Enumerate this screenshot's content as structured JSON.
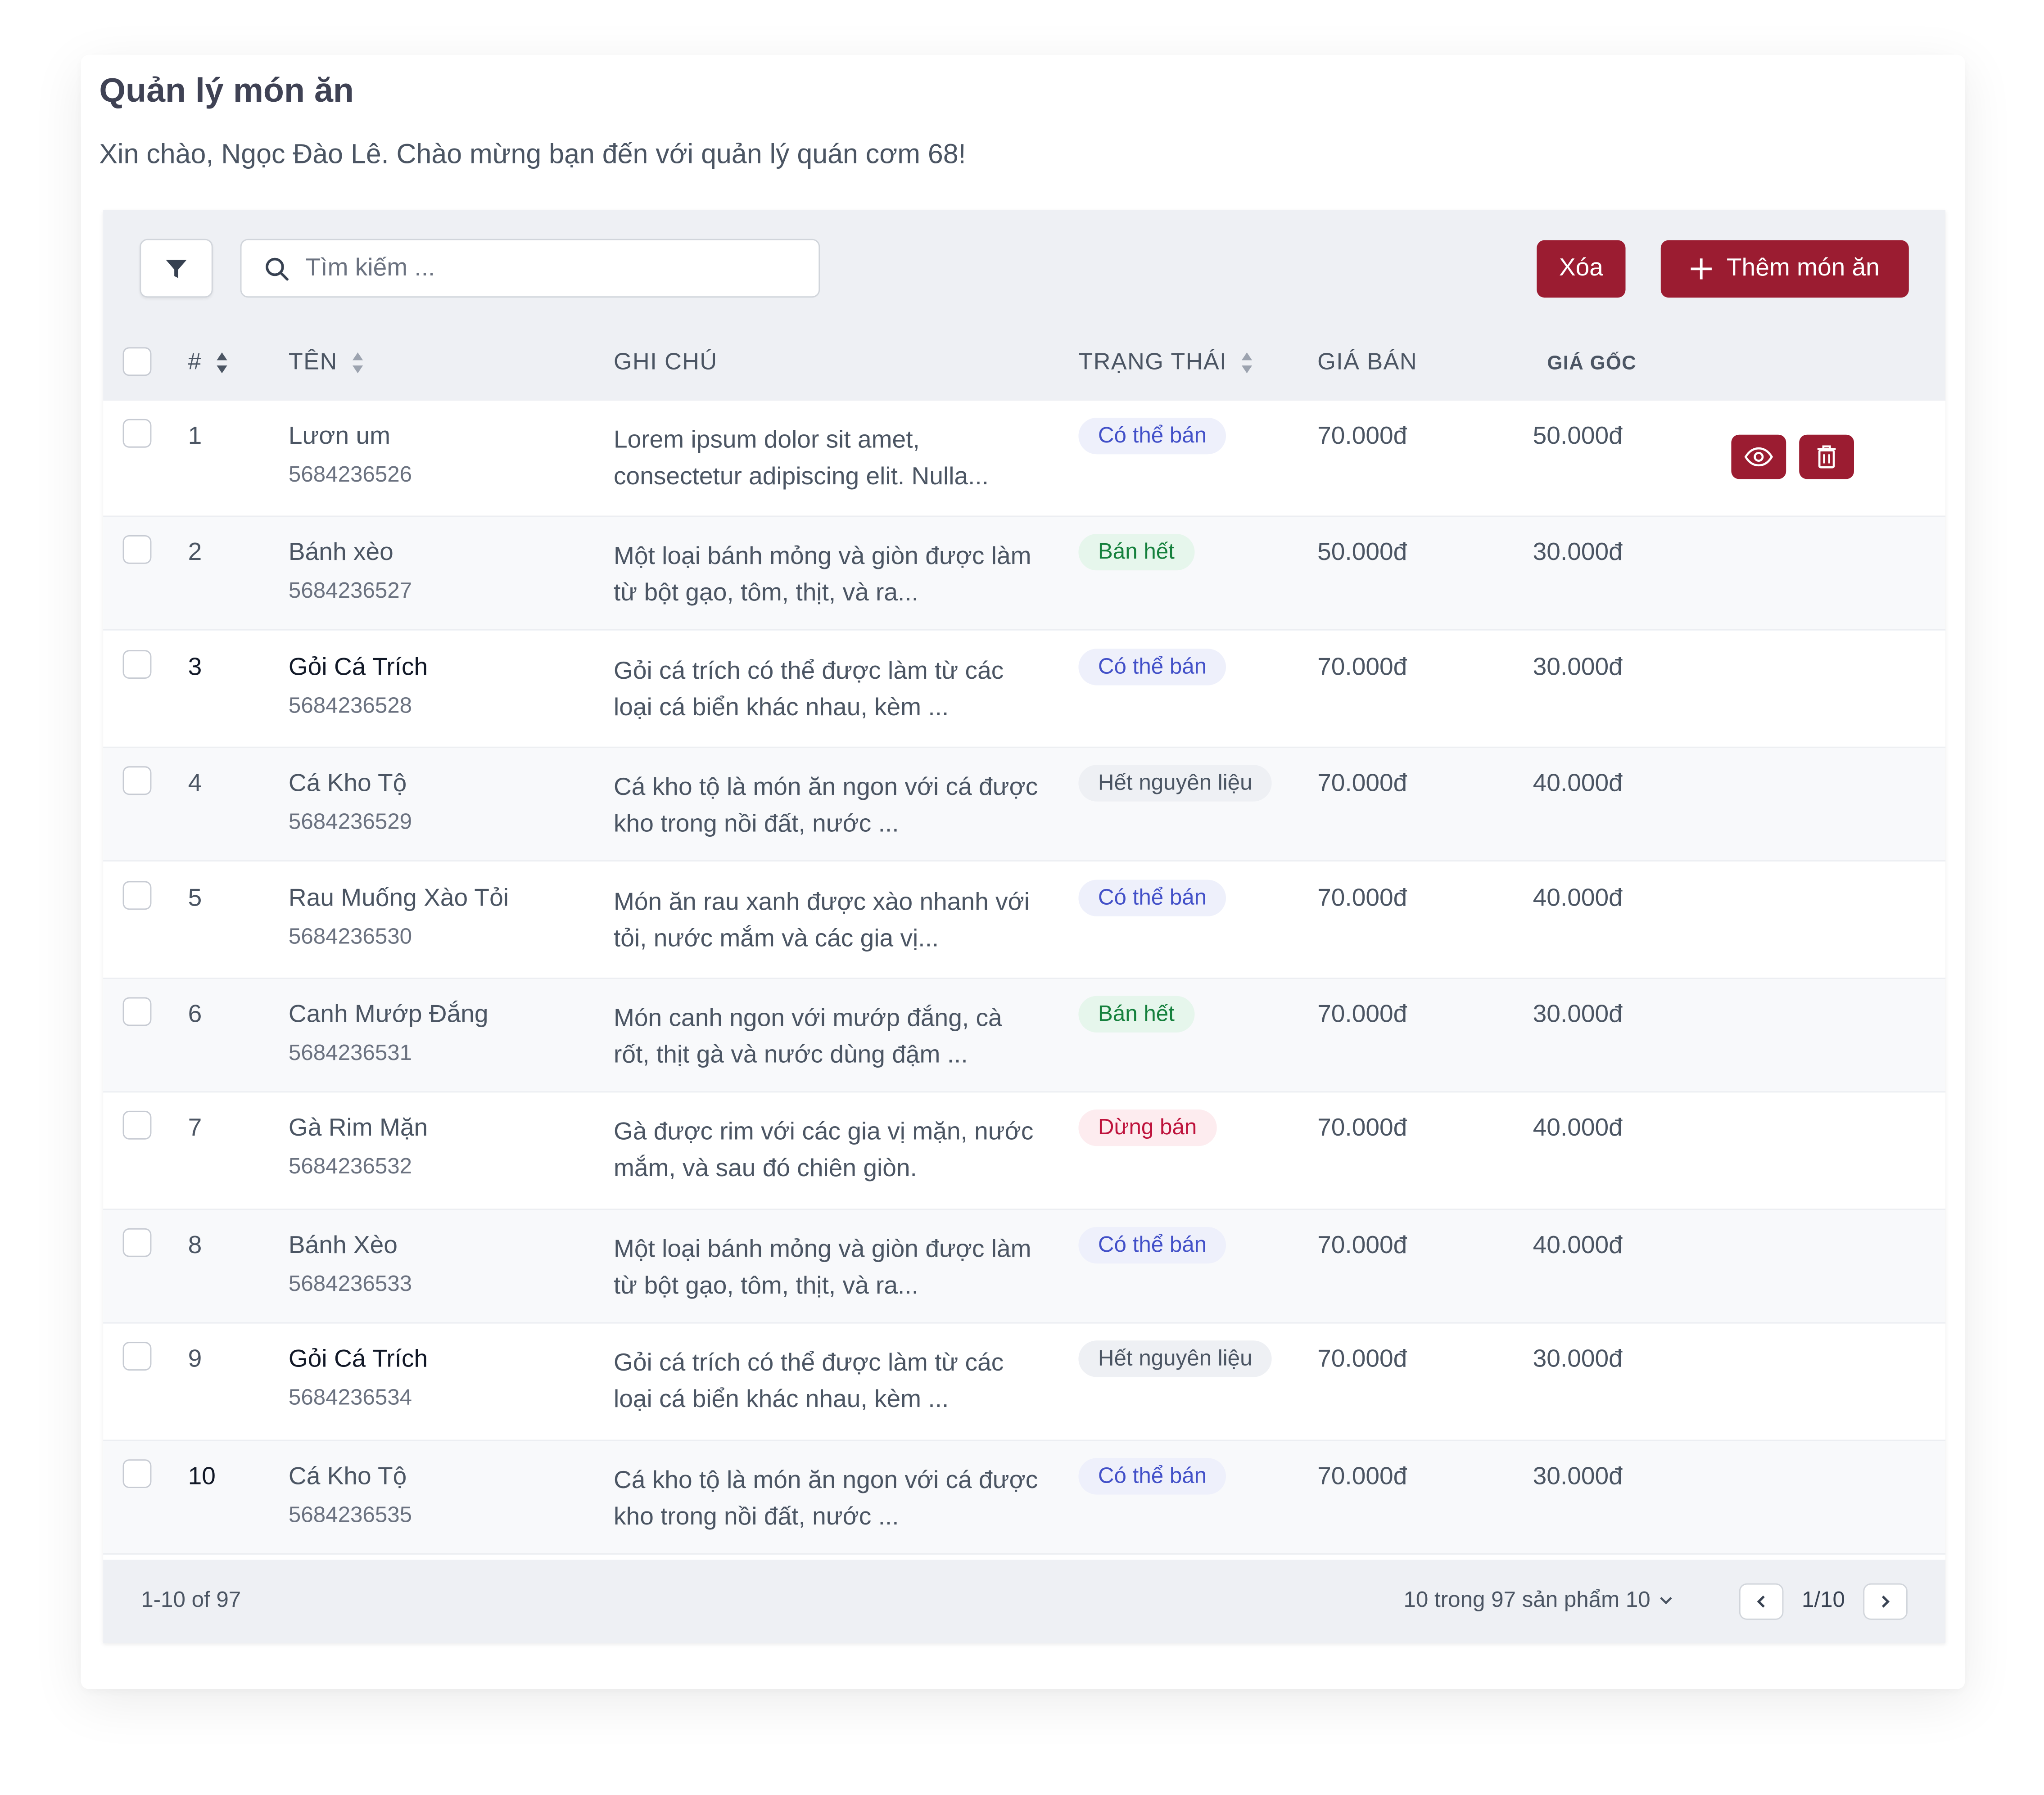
{
  "page": {
    "title": "Quản lý món ăn",
    "subtitle": "Xin chào, Ngọc Đào Lê. Chào mừng bạn đến với quản lý quán cơm 68!"
  },
  "toolbar": {
    "search_placeholder": "Tìm kiếm ...",
    "delete_label": "Xóa",
    "add_label": "Thêm món ăn"
  },
  "columns": {
    "index": "#",
    "name": "TÊN",
    "note": "GHI CHÚ",
    "status": "TRẠNG THÁI",
    "price": "GIÁ BÁN",
    "cost": "GIÁ GỐC"
  },
  "status_colors": {
    "Có thể bán": {
      "bg": "#eef0fb",
      "fg": "#4250c8"
    },
    "Bán hết": {
      "bg": "#e6f6ec",
      "fg": "#15803d"
    },
    "Hết nguyên liệu": {
      "bg": "#eef0f4",
      "fg": "#4b5563"
    },
    "Dừng bán": {
      "bg": "#fdecef",
      "fg": "#be123c"
    }
  },
  "rows": [
    {
      "index": "1",
      "name": "Lươn um",
      "code": "5684236526",
      "note": "Lorem ipsum dolor  sit amet, consectetur adipiscing elit. Nulla...",
      "status": "Có thể bán",
      "price": "70.000đ",
      "cost": "50.000đ",
      "bold": false
    },
    {
      "index": "2",
      "name": "Bánh xèo",
      "code": "5684236527",
      "note": "Một loại bánh mỏng và giòn được làm từ bột gạo, tôm, thịt, và ra...",
      "status": "Bán hết",
      "price": "50.000đ",
      "cost": "30.000đ",
      "bold": false
    },
    {
      "index": "3",
      "name": "Gỏi Cá Trích",
      "code": "5684236528",
      "note": "Gỏi cá trích có thể được làm từ các loại cá biển khác nhau, kèm ...",
      "status": "Có thể bán",
      "price": "70.000đ",
      "cost": "30.000đ",
      "bold": true
    },
    {
      "index": "4",
      "name": "Cá Kho Tộ",
      "code": "5684236529",
      "note": "Cá kho tộ là món ăn ngon với cá được kho trong nồi đất, nước ...",
      "status": "Hết nguyên liệu",
      "price": "70.000đ",
      "cost": "40.000đ",
      "bold": false
    },
    {
      "index": "5",
      "name": "Rau Muống Xào Tỏi",
      "code": "5684236530",
      "note": "Món ăn rau xanh được xào nhanh với tỏi, nước mắm và các gia vị...",
      "status": "Có thể bán",
      "price": "70.000đ",
      "cost": "40.000đ",
      "bold": false
    },
    {
      "index": "6",
      "name": "Canh Mướp Đắng",
      "code": "5684236531",
      "note": "Món canh ngon với mướp đắng, cà rốt, thịt gà và nước dùng đậm ...",
      "status": "Bán hết",
      "price": "70.000đ",
      "cost": "30.000đ",
      "bold": false
    },
    {
      "index": "7",
      "name": "Gà Rim Mặn",
      "code": "5684236532",
      "note": "Gà được rim với các gia vị mặn, nước mắm, và sau đó chiên giòn.",
      "status": "Dừng bán",
      "price": "70.000đ",
      "cost": "40.000đ",
      "bold": false
    },
    {
      "index": "8",
      "name": "Bánh Xèo",
      "code": "5684236533",
      "note": "Một loại bánh mỏng và giòn được làm từ bột gạo, tôm, thịt, và ra...",
      "status": "Có thể bán",
      "price": "70.000đ",
      "cost": "40.000đ",
      "bold": false
    },
    {
      "index": "9",
      "name": "Gỏi Cá Trích",
      "code": "5684236534",
      "note": "Gỏi cá trích có thể được làm từ các loại cá biển khác nhau, kèm ...",
      "status": "Hết nguyên liệu",
      "price": "70.000đ",
      "cost": "30.000đ",
      "bold": true
    },
    {
      "index": "10",
      "name": "Cá Kho Tộ",
      "code": "5684236535",
      "note": "Cá kho tộ là món ăn ngon với cá được kho trong nồi đất, nước ...",
      "status": "Có thể bán",
      "price": "70.000đ",
      "cost": "30.000đ",
      "bold": false
    }
  ],
  "row_actions": {
    "icons": [
      "eye-icon",
      "trash-icon"
    ]
  },
  "footer": {
    "range": "1-10 of 97",
    "per_page": "10 trong 97 sản phẩm 10",
    "page_label": "1/10"
  },
  "accent": "#9b1c31"
}
